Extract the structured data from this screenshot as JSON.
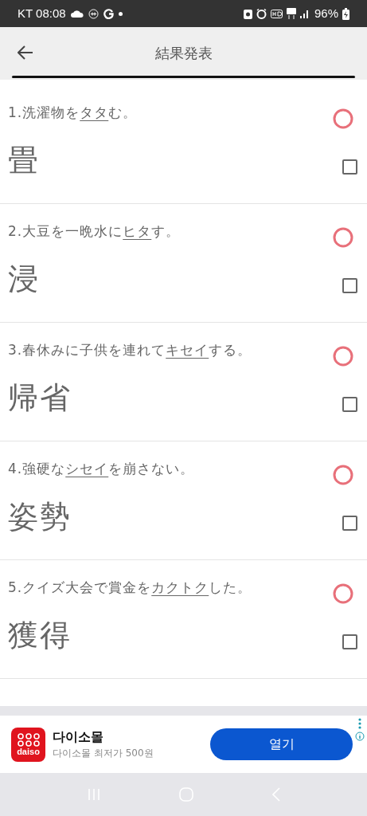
{
  "status_bar": {
    "carrier_time": "KT 08:08",
    "battery": "96%"
  },
  "header": {
    "title": "結果発表"
  },
  "questions": [
    {
      "before": "1.洗濯物を",
      "underlined": "タタ",
      "after": "む。",
      "answer": "畳",
      "correct": true,
      "checked": false
    },
    {
      "before": "2.大豆を一晩水に",
      "underlined": "ヒタ",
      "after": "す。",
      "answer": "浸",
      "correct": true,
      "checked": false
    },
    {
      "before": "3.春休みに子供を連れて",
      "underlined": "キセイ",
      "after": "する。",
      "answer": "帰省",
      "correct": true,
      "checked": false
    },
    {
      "before": "4.強硬な",
      "underlined": "シセイ",
      "after": "を崩さない。",
      "answer": "姿勢",
      "correct": true,
      "checked": false
    },
    {
      "before": "5.クイズ大会で賞金を",
      "underlined": "カクトク",
      "after": "した。",
      "answer": "獲得",
      "correct": true,
      "checked": false
    }
  ],
  "ad": {
    "logo_text": "daiso",
    "title": "다이소몰",
    "subtitle": "다이소몰 최저가 500원",
    "button": "열기"
  }
}
